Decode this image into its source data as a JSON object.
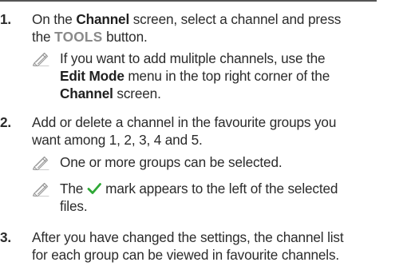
{
  "step1": {
    "number": "1.",
    "part1": "On the ",
    "channel": "Channel",
    "part2": " screen, select a channel and press",
    "part3": "the ",
    "tools": "TOOLS",
    "part4": " button."
  },
  "note1": {
    "line1": "If you want to add mulitple channels, use the",
    "edit_mode": "Edit Mode",
    "line2_rest": " menu in the top right corner of the",
    "channel": "Channel",
    "line3_rest": " screen."
  },
  "step2": {
    "number": "2.",
    "line1": "Add or delete a channel in the favourite groups you",
    "line2": "want among 1, 2, 3, 4 and 5."
  },
  "note2": {
    "line1": "One or more groups can be selected."
  },
  "note3": {
    "before": "The",
    "after": "mark appears to the left of the selected",
    "line2": "files.",
    "check_color": "#2ea836"
  },
  "step3": {
    "number": "3.",
    "line1": "After you have changed the settings, the channel list",
    "line2": "for each group can be viewed in favourite channels."
  },
  "colors": {
    "text": "#2b2b2b",
    "tools": "#8a8a8a",
    "note_icon": "#9a9a9a",
    "rule": "#555555"
  },
  "icons": {
    "note": "pencil-note-icon",
    "check": "checkmark-icon"
  }
}
